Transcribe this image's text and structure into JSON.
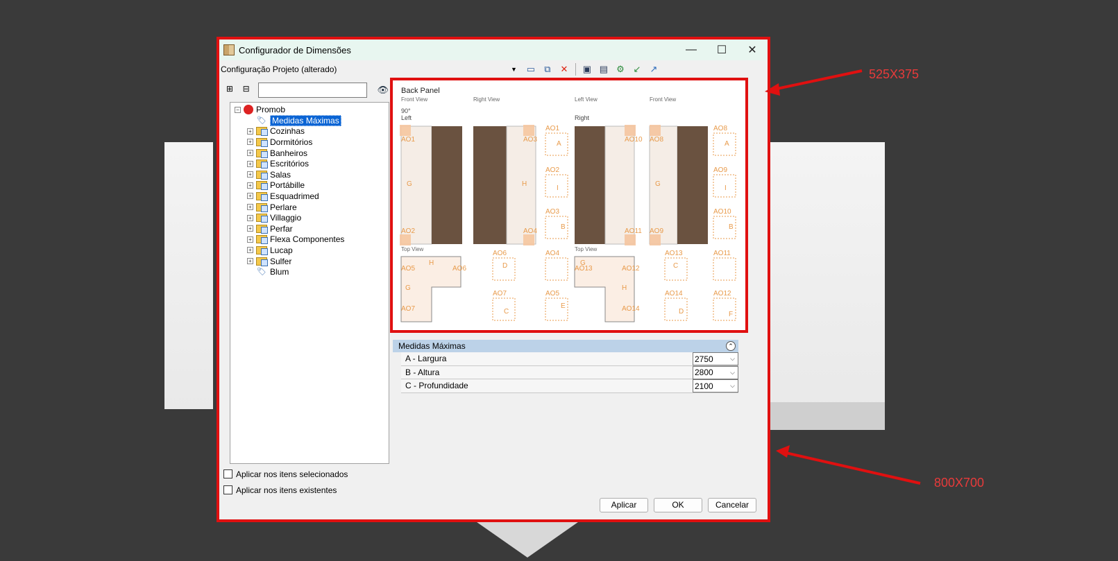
{
  "window": {
    "title": "Configurador de Dimensões",
    "minimize": "—",
    "maximize": "☐",
    "close": "✕"
  },
  "config": {
    "label": "Configuração Projeto (alterado)"
  },
  "tree": {
    "root": "Promob",
    "items": [
      {
        "label": "Medidas Máximas",
        "type": "tag",
        "selected": true
      },
      {
        "label": "Cozinhas",
        "type": "folder"
      },
      {
        "label": "Dormitórios",
        "type": "folder"
      },
      {
        "label": "Banheiros",
        "type": "folder"
      },
      {
        "label": "Escritórios",
        "type": "folder"
      },
      {
        "label": "Salas",
        "type": "folder"
      },
      {
        "label": "Portábille",
        "type": "folder"
      },
      {
        "label": "Esquadrimed",
        "type": "folder"
      },
      {
        "label": "Perlare",
        "type": "folder"
      },
      {
        "label": "Villaggio",
        "type": "folder"
      },
      {
        "label": "Perfar",
        "type": "folder"
      },
      {
        "label": "Flexa Componentes",
        "type": "folder"
      },
      {
        "label": "Lucap",
        "type": "folder"
      },
      {
        "label": "Sulfer",
        "type": "folder"
      },
      {
        "label": "Blum",
        "type": "tag"
      }
    ]
  },
  "checks": {
    "selected": "Aplicar nos itens selecionados",
    "existing": "Aplicar nos itens existentes"
  },
  "preview": {
    "title": "Back Panel",
    "front_view": "Front View",
    "right_view": "Right View",
    "left_view": "Left View",
    "front_view_2": "Front View",
    "angle": "90°",
    "left": "Left",
    "right": "Right",
    "top_view": "Top View",
    "top_view_2": "Top View",
    "labels": {
      "ao1": "AO1",
      "ao2": "AO2",
      "ao3": "AO3",
      "ao4": "AO4",
      "ao5": "AO5",
      "ao6": "AO6",
      "ao7": "AO7",
      "ao8": "AO8",
      "ao9": "AO9",
      "ao10": "AO10",
      "ao11": "AO11",
      "ao12": "AO12",
      "ao13": "AO13",
      "ao14": "AO14",
      "g": "G",
      "h": "H",
      "a": "A",
      "b": "B",
      "c": "C",
      "d": "D",
      "e": "E",
      "f": "F",
      "i": "I"
    }
  },
  "props": {
    "header": "Medidas Máximas",
    "rows": [
      {
        "name": "A - Largura",
        "value": "2750"
      },
      {
        "name": "B - Altura",
        "value": "2800"
      },
      {
        "name": "C - Profundidade",
        "value": "2100"
      }
    ]
  },
  "buttons": {
    "apply": "Aplicar",
    "ok": "OK",
    "cancel": "Cancelar"
  },
  "annotations": {
    "preview_size": "525X375",
    "dialog_size": "800X700"
  },
  "colors": {
    "highlight": "#e01010",
    "annotation": "#e83a3a",
    "selection": "#0a64d4",
    "dimension_orange": "#e89a4a",
    "wood": "#6a5240"
  }
}
